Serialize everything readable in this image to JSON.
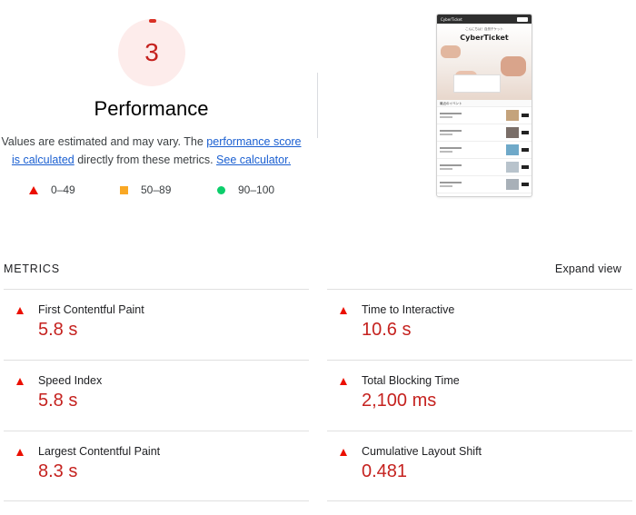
{
  "score": {
    "value": "3",
    "title": "Performance",
    "color": "#c5221f"
  },
  "description": {
    "text_before": "Values are estimated and may vary. The ",
    "link1": "performance score is calculated",
    "text_middle": " directly from these metrics. ",
    "link2": "See calculator."
  },
  "legend": [
    {
      "shape": "triangle-red",
      "range": "0–49"
    },
    {
      "shape": "square-orange",
      "range": "50–89"
    },
    {
      "shape": "circle-green",
      "range": "90–100"
    }
  ],
  "thumbnail": {
    "logo": "CyberTicket",
    "hero_subtitle": "こんにちは！自然チケット",
    "hero_title": "CyberTicket",
    "section_title": "最近のイベント"
  },
  "metrics": {
    "header": "METRICS",
    "expand_label": "Expand view",
    "items": [
      {
        "name": "First Contentful Paint",
        "value": "5.8 s"
      },
      {
        "name": "Time to Interactive",
        "value": "10.6 s"
      },
      {
        "name": "Speed Index",
        "value": "5.8 s"
      },
      {
        "name": "Total Blocking Time",
        "value": "2,100 ms"
      },
      {
        "name": "Largest Contentful Paint",
        "value": "8.3 s"
      },
      {
        "name": "Cumulative Layout Shift",
        "value": "0.481"
      }
    ]
  },
  "colors": {
    "fail": "#eb0f00",
    "average": "#f9a825",
    "pass": "#0cce6b",
    "link": "#1a5fd1"
  }
}
